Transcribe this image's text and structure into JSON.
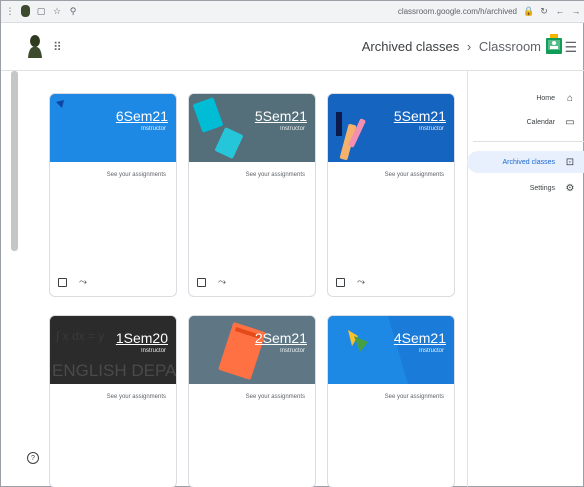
{
  "browser": {
    "url": "classroom.google.com/h/archived",
    "extensions_icon": "puzzle-icon",
    "reload_icon": "reload-icon"
  },
  "header": {
    "brand": "Classroom",
    "separator": "›",
    "current": "Archived classes",
    "menu_icon": "hamburger-icon",
    "apps_icon": "apps-grid-icon"
  },
  "sidebar": {
    "items": [
      {
        "label": "Home",
        "icon": "home-icon",
        "active": false
      },
      {
        "label": "Calendar",
        "icon": "calendar-icon",
        "active": false
      },
      {
        "label": "Archived classes",
        "icon": "archive-icon",
        "active": true
      },
      {
        "label": "Settings",
        "icon": "settings-icon",
        "active": false
      }
    ]
  },
  "cards": [
    {
      "title": "5Sem21",
      "subtitle": "Instructor",
      "link": "See your assignments",
      "color": "#1a73e8",
      "art": "pencil"
    },
    {
      "title": "5Sem21",
      "subtitle": "Instructor",
      "link": "See your assignments",
      "color": "#546e7a",
      "art": "notebook"
    },
    {
      "title": "6Sem21",
      "subtitle": "Instructor",
      "link": "See your assignments",
      "color": "#1e88e5",
      "art": "plain"
    },
    {
      "title": "4Sem21",
      "subtitle": "Instructor",
      "link": "See your assignments",
      "color": "#1976d2",
      "art": "abstract"
    },
    {
      "title": "2Sem21",
      "subtitle": "Instructor",
      "link": "See your assignments",
      "color": "#546e7a",
      "art": "book"
    },
    {
      "title": "1Sem20",
      "subtitle": "Instructor",
      "link": "See your assignments",
      "color": "#3c4043",
      "art": "english"
    }
  ],
  "colors": {
    "accent": "#1967d2",
    "active_bg": "#e8f0fe",
    "divider": "#e0e0e0"
  }
}
